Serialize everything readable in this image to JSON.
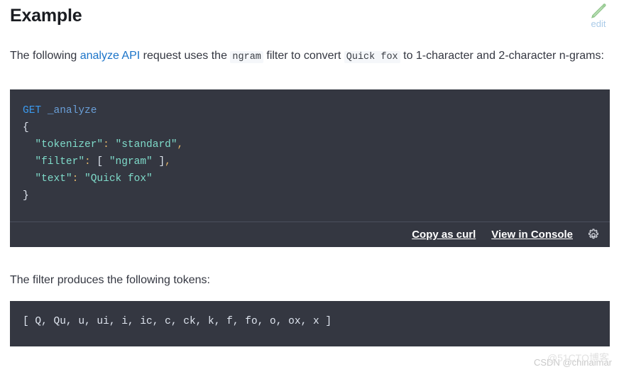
{
  "heading": {
    "title": "Example"
  },
  "edit": {
    "label": "edit",
    "icon": "pencil-icon",
    "icon_color": "#a8d5a2",
    "label_color": "#aacbe8"
  },
  "intro_paragraph": {
    "part1": "The following ",
    "link": "analyze API",
    "part2": " request uses the ",
    "code1": "ngram",
    "part3": " filter to convert ",
    "code2": "Quick fox",
    "part4": " to 1-character and 2-character n-grams:",
    "link_color": "#1a73c8"
  },
  "request_block": {
    "background": "#343741",
    "lines": [
      {
        "method": "GET",
        "path": "_analyze"
      },
      {
        "text": "{"
      },
      {
        "key": "\"tokenizer\"",
        "colon": ":",
        "value": " \"standard\"",
        "trail": ","
      },
      {
        "key": "\"filter\"",
        "colon": ":",
        "bracket_open": " [ ",
        "value": "\"ngram\"",
        "bracket_close": " ]",
        "trail": ","
      },
      {
        "key": "\"text\"",
        "colon": ":",
        "value": " \"Quick fox\""
      },
      {
        "text": "}"
      }
    ],
    "raw": "GET _analyze\n{\n  \"tokenizer\": \"standard\",\n  \"filter\": [ \"ngram\" ],\n  \"text\": \"Quick fox\"\n}",
    "footer": {
      "copy_label": "Copy as curl",
      "console_label": "View in Console",
      "settings_icon": "gear-icon"
    }
  },
  "tokens_paragraph": {
    "text": "The filter produces the following tokens:"
  },
  "response_block": {
    "background": "#343741",
    "text": "[ Q, Qu, u, ui, i, ic, c, ck, k, f, fo, o, ox, x ]"
  },
  "watermark": {
    "line1": "CSDN @chinaimar",
    "line2": "@51CTO博客"
  }
}
